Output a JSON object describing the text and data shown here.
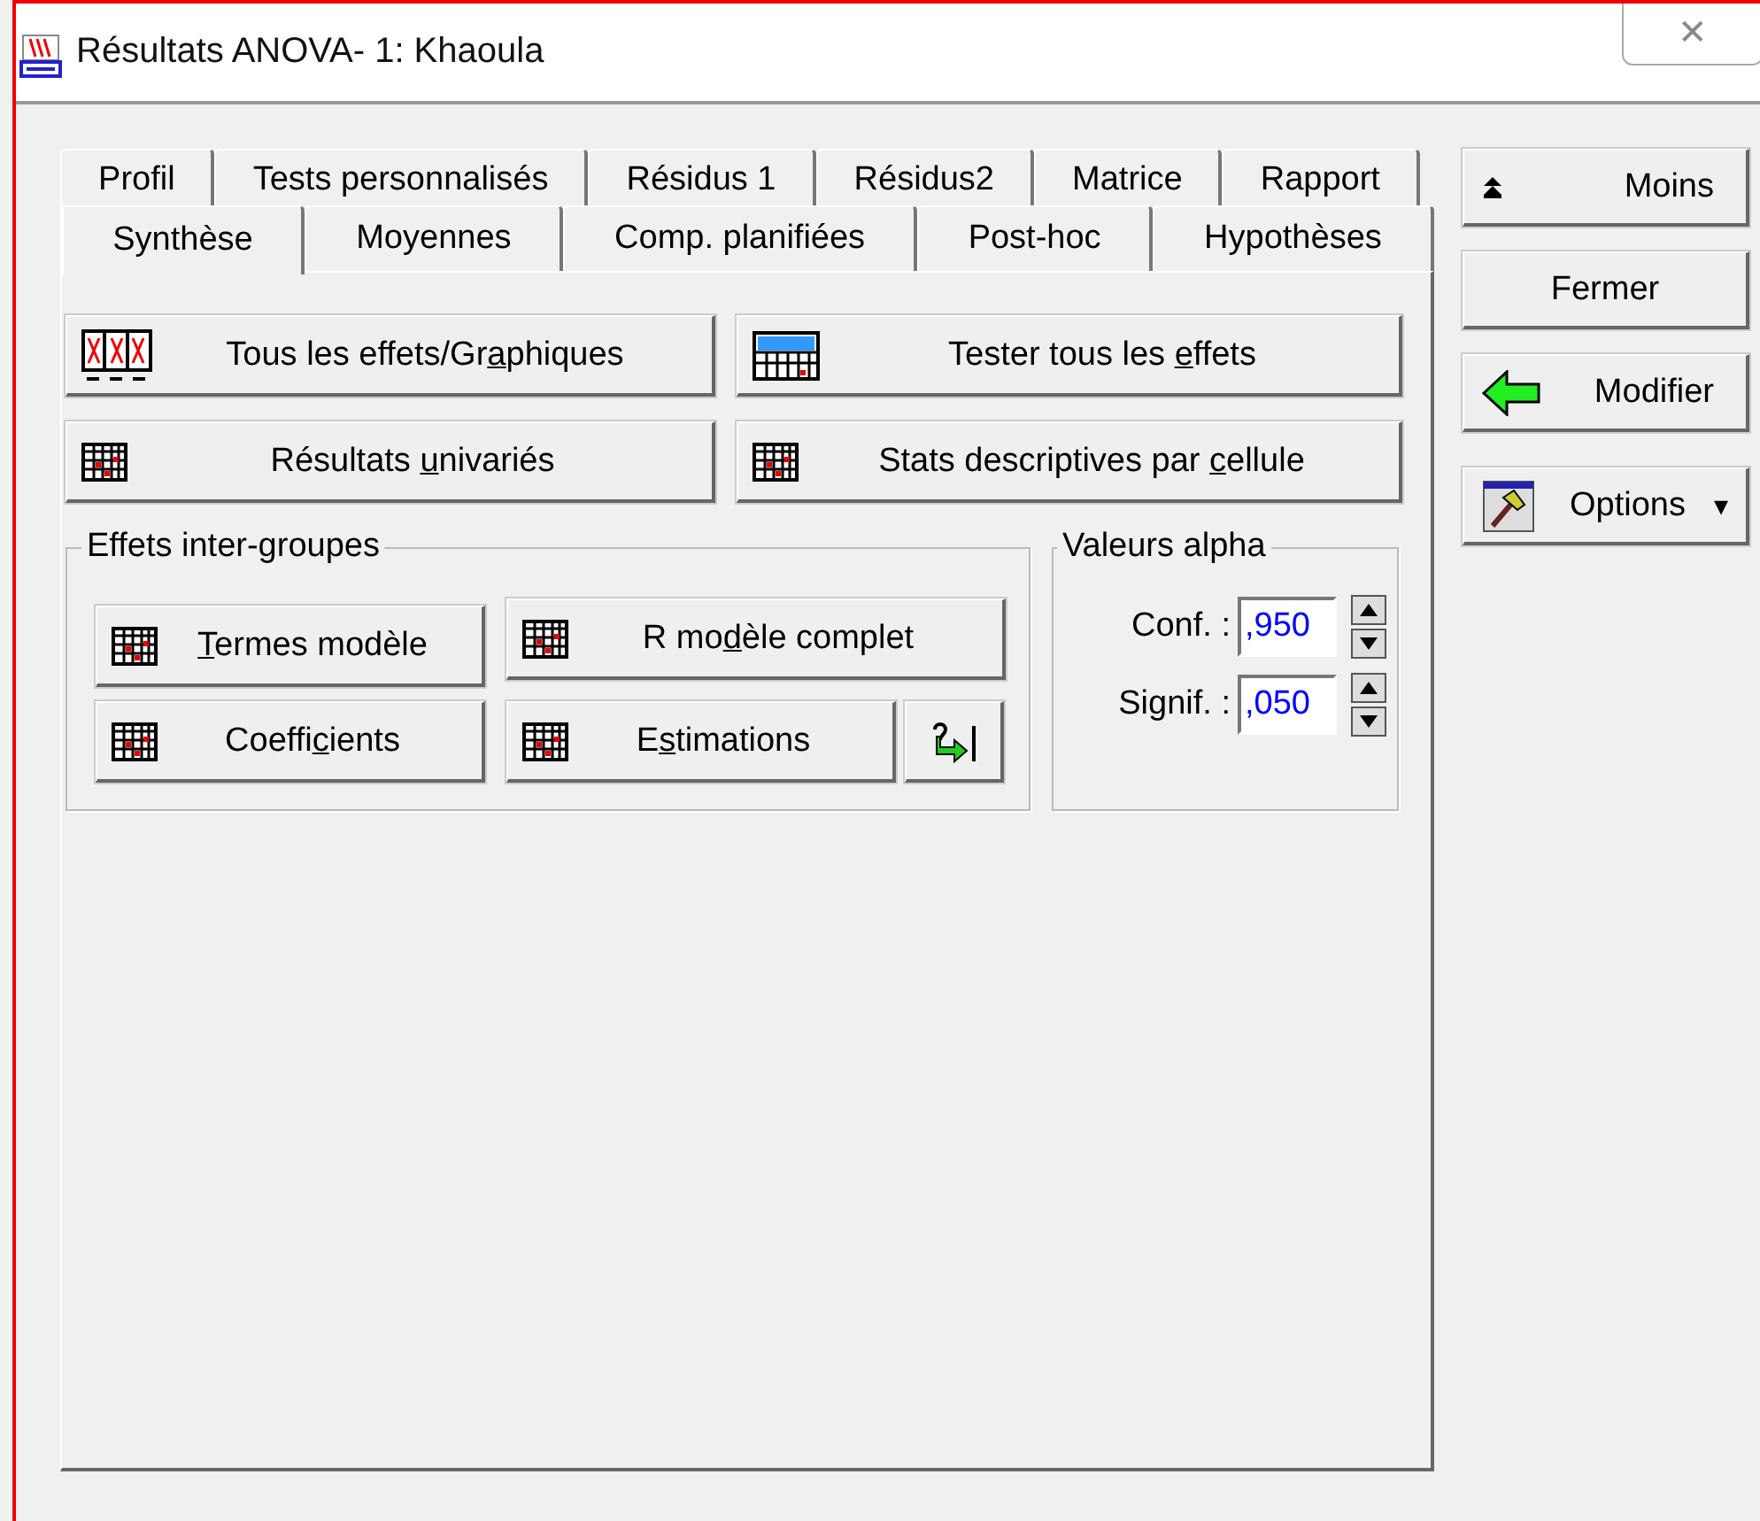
{
  "window": {
    "title": "Résultats ANOVA- 1: Khaoula",
    "close": "✕"
  },
  "tab_rows": [
    {
      "tabs": [
        {
          "label": "Profil",
          "selected": false
        },
        {
          "label": "Tests personnalisés",
          "selected": false
        },
        {
          "label": "Résidus 1",
          "selected": false
        },
        {
          "label": "Résidus2",
          "selected": false
        },
        {
          "label": "Matrice",
          "selected": false
        },
        {
          "label": "Rapport",
          "selected": false
        }
      ]
    },
    {
      "tabs": [
        {
          "label": "Synthèse",
          "selected": true
        },
        {
          "label": "Moyennes",
          "selected": false
        },
        {
          "label": "Comp. planifiées",
          "selected": false
        },
        {
          "label": "Post-hoc",
          "selected": false
        },
        {
          "label": "Hypothèses",
          "selected": false
        }
      ]
    }
  ],
  "main_buttons": [
    {
      "kind": "chart",
      "before": "Tous les effets/Gr",
      "key": "a",
      "after": "phiques"
    },
    {
      "kind": "sum",
      "before": "Tester tous les ",
      "key": "e",
      "after": "ffets"
    },
    {
      "kind": "grid",
      "before": "Résultats ",
      "key": "u",
      "after": "nivariés"
    },
    {
      "kind": "grid",
      "before": "Stats descriptives par ",
      "key": "c",
      "after": "ellule"
    }
  ],
  "effects_group": {
    "title": "Effets inter-groupes",
    "buttons": [
      {
        "kind": "grid",
        "key": "T",
        "after": "ermes modèle"
      },
      {
        "kind": "grid",
        "before": "R mo",
        "key": "d",
        "after": "èle complet"
      },
      {
        "kind": "grid",
        "before": "Coeffi",
        "key": "c",
        "after": "ients"
      },
      {
        "kind": "grid",
        "before": "E",
        "key": "s",
        "after": "timations"
      }
    ]
  },
  "alpha_group": {
    "title": "Valeurs alpha",
    "fields": [
      {
        "label": "Conf. :",
        "value": ",950"
      },
      {
        "label": "Signif. :",
        "value": ",050"
      }
    ]
  },
  "side_buttons": [
    {
      "kind": "up",
      "label": "Moins"
    },
    {
      "kind": "plain",
      "label": "Fermer"
    },
    {
      "kind": "back",
      "label": "Modifier"
    },
    {
      "kind": "options",
      "label": "Options",
      "caret": "▾"
    }
  ]
}
